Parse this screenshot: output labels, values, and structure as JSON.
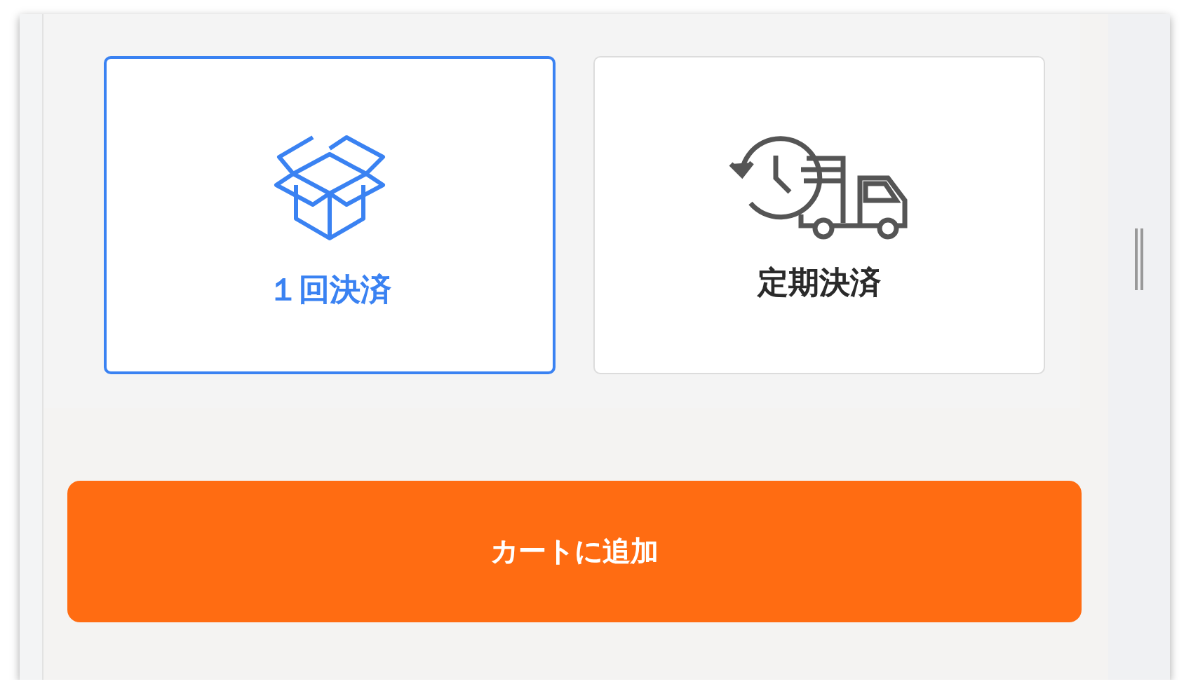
{
  "payment_options": [
    {
      "kind": "one_time",
      "label": "１回決済",
      "selected": true
    },
    {
      "kind": "subscription",
      "label": "定期決済",
      "selected": false
    }
  ],
  "add_to_cart_button": {
    "label": "カートに追加"
  }
}
